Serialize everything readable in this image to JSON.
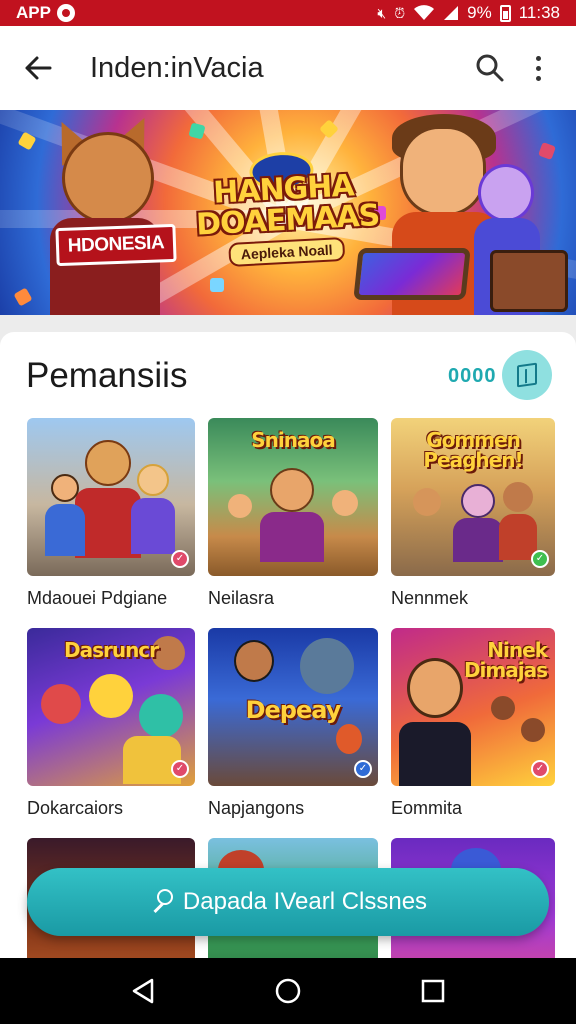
{
  "status_bar": {
    "app_label": "APP",
    "battery_text": "9%",
    "time": "11:38",
    "icons": [
      "app-icon",
      "mute-icon",
      "alarm-icon",
      "wifi-icon",
      "signal-icon",
      "battery-icon"
    ]
  },
  "app_bar": {
    "title": "Inden:inVacia",
    "back_icon": "arrow-left-icon",
    "search_icon": "search-icon",
    "more_icon": "more-vertical-icon"
  },
  "banner": {
    "flag_text": "HDONESIA",
    "title_line1": "HANGHA",
    "title_line2": "DOAEMAAS",
    "subtitle": "Aepleka Noall"
  },
  "section": {
    "title": "Pemansiis",
    "count": "0000",
    "action_icon": "book-icon"
  },
  "games": [
    {
      "label": "Mdaouei Pdgiane",
      "thumb_title": "",
      "badge": "pink"
    },
    {
      "label": "Neilasra",
      "thumb_title": "Sninaoa",
      "badge": ""
    },
    {
      "label": "Nennmek",
      "thumb_title": "Gommen Peaghen!",
      "badge": "green"
    },
    {
      "label": "Dokarcaiors",
      "thumb_title": "Dasruncr",
      "badge": "pink"
    },
    {
      "label": "Napjangons",
      "thumb_title": "Depeay",
      "badge": "blue"
    },
    {
      "label": "Eommita",
      "thumb_title": "Ninek Dimajas",
      "badge": "pink"
    },
    {
      "label": "",
      "thumb_title": "",
      "badge": ""
    },
    {
      "label": "",
      "thumb_title": "",
      "badge": ""
    },
    {
      "label": "",
      "thumb_title": "",
      "badge": ""
    }
  ],
  "fab": {
    "label": "Dapada IVearl Clssnes",
    "icon": "microphone-icon"
  },
  "nav_bar": {
    "icons": [
      "back-triangle-icon",
      "home-circle-icon",
      "recents-square-icon"
    ]
  },
  "colors": {
    "status_bar": "#c1121f",
    "accent_teal": "#1fa9b0",
    "fab_teal": "#26b0b8"
  }
}
